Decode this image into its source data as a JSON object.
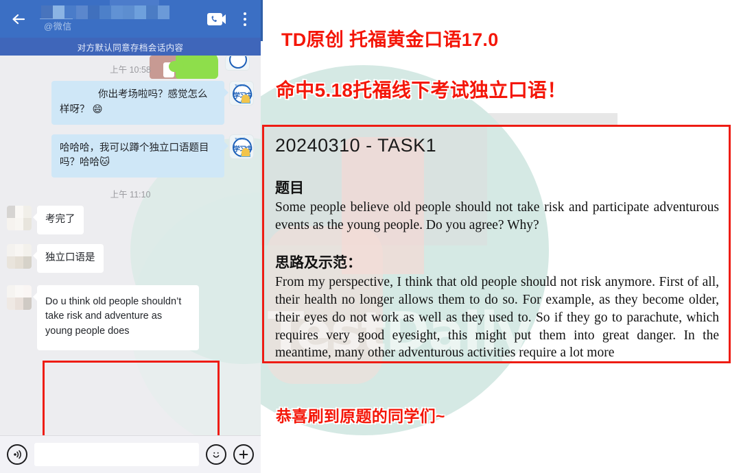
{
  "chat": {
    "header": {
      "back_icon": "back-arrow-icon",
      "name_redacted": "",
      "at_handle": "@微信",
      "call_icon": "video-call-icon",
      "menu_icon": "more-options-icon",
      "archive_notice": "对方默认同意存档会话内容"
    },
    "messages": [
      {
        "type": "timestamp",
        "text": "上午 10:58"
      },
      {
        "type": "bubble",
        "side": "right",
        "style": "blue",
        "text_indent": "你出考场啦吗？感觉怎么样呀？ 😄",
        "avatar": "study-badge-avatar"
      },
      {
        "type": "bubble",
        "side": "right",
        "style": "blue",
        "text": "哈哈哈，我可以蹲个独立口语题目吗？哈哈🐱",
        "avatar": "study-badge-avatar"
      },
      {
        "type": "timestamp",
        "text": "上午 11:10"
      },
      {
        "type": "bubble",
        "side": "left",
        "style": "white",
        "text": "考完了"
      },
      {
        "type": "bubble",
        "side": "left",
        "style": "white",
        "text": "独立口语是"
      },
      {
        "type": "bubble",
        "side": "left",
        "style": "white",
        "text": "Do u think old people shouldn’t take risk and adventure as young people does"
      }
    ],
    "input_bar": {
      "voice_icon": "voice-message-icon",
      "input_value": "",
      "input_placeholder": "",
      "emoji_icon": "emoji-smiley-icon",
      "plus_icon": "add-more-icon"
    },
    "highlight_color": "#ee1c13"
  },
  "poster": {
    "headline_1": "TD原创 托福黄金口语17.0",
    "headline_2": "命中5.18托福线下考试独立口语！",
    "footer_note": "恭喜刷到原题的同学们~",
    "headline_color": "#f41608",
    "watermark": "TestDaily",
    "document": {
      "title": "20240310 - TASK1",
      "section1_heading": "题目",
      "section1_body": "Some people believe old people should not take risk and participate adventurous events as the young people. Do you agree? Why?",
      "section2_heading": "思路及示范：",
      "section2_body": "From my perspective, I think that old people should not risk anymore. First of all, their health no longer allows them to do so. For example, as they become older, their eyes do not work as well as they used to. So if they go to parachute, which requires very good eyesight, this might put them into great danger. In the meantime, many other adventurous activities require a lot more"
    }
  }
}
